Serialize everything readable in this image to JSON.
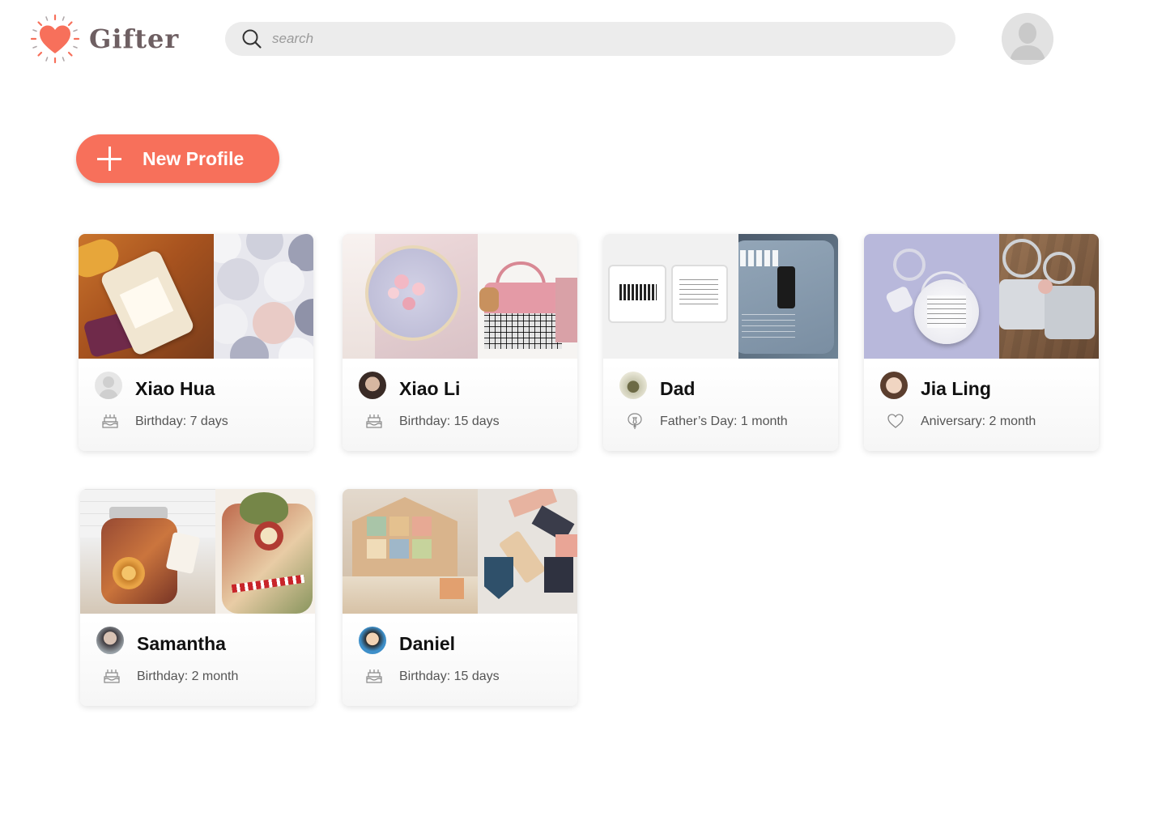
{
  "app": {
    "name": "Gifter"
  },
  "colors": {
    "accent": "#f7705b",
    "logo_text": "#6e5f62",
    "search_bg": "#ececec"
  },
  "search": {
    "placeholder": "search"
  },
  "actions": {
    "new_profile_label": "New Profile"
  },
  "profiles": [
    {
      "name": "Xiao Hua",
      "event": "Birthday: 7 days",
      "event_icon": "cake-icon"
    },
    {
      "name": "Xiao Li",
      "event": "Birthday: 15 days",
      "event_icon": "cake-icon"
    },
    {
      "name": "Dad",
      "event": "Father’s Day: 1 month",
      "event_icon": "tie-balloon-icon"
    },
    {
      "name": "Jia Ling",
      "event": "Aniversary: 2 month",
      "event_icon": "heart-icon"
    },
    {
      "name": "Samantha",
      "event": "Birthday: 2 month",
      "event_icon": "cake-icon"
    },
    {
      "name": "Daniel",
      "event": "Birthday: 15 days",
      "event_icon": "cake-icon"
    }
  ]
}
